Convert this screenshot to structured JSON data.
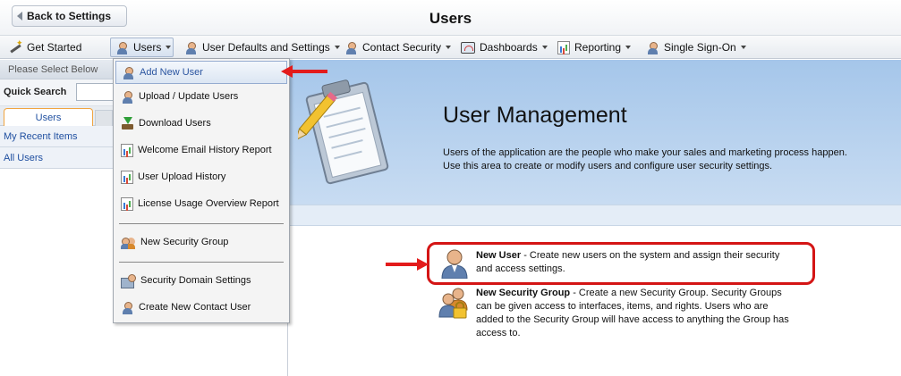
{
  "header": {
    "back_label": "Back to Settings",
    "title": "Users"
  },
  "menubar": {
    "items": [
      {
        "label": "Get Started",
        "icon": "wand-icon"
      },
      {
        "label": "Users",
        "icon": "user-icon"
      },
      {
        "label": "User Defaults and Settings",
        "icon": "user-icon"
      },
      {
        "label": "Contact Security",
        "icon": "user-icon"
      },
      {
        "label": "Dashboards",
        "icon": "dashboard-icon"
      },
      {
        "label": "Reporting",
        "icon": "report-icon"
      },
      {
        "label": "Single Sign-On",
        "icon": "user-icon"
      }
    ]
  },
  "sidebar": {
    "heading": "Please Select Below",
    "quick_search_label": "Quick Search",
    "quick_search_value": "",
    "tab_label": "Users",
    "links": [
      "My Recent Items",
      "All Users"
    ]
  },
  "dropdown": {
    "items": [
      {
        "label": "Add New User",
        "icon": "user-icon"
      },
      {
        "label": "Upload / Update Users",
        "icon": "user-icon"
      },
      {
        "label": "Download Users",
        "icon": "download-icon"
      },
      {
        "label": "Welcome Email History Report",
        "icon": "report-icon"
      },
      {
        "label": "User Upload History",
        "icon": "report-icon"
      },
      {
        "label": "License Usage Overview Report",
        "icon": "report-icon"
      },
      {
        "label": "New Security Group",
        "icon": "group-icon"
      },
      {
        "label": "Security Domain Settings",
        "icon": "domain-icon"
      },
      {
        "label": "Create New Contact User",
        "icon": "user-icon"
      }
    ]
  },
  "banner": {
    "title": "User Management",
    "description": "Users of the application are the people who make your sales and marketing process happen. Use this area to create or modify users and configure user security settings."
  },
  "entries": {
    "new_user": {
      "title": "New User",
      "text": " - Create new users on the system and assign their security and access settings."
    },
    "new_group": {
      "title": "New Security Group",
      "text": " - Create a new Security Group. Security Groups can be given access to interfaces, items, and rights. Users who are added to the Security Group will have access to anything the Group has access to."
    }
  },
  "colors": {
    "accent_red": "#e31b1b",
    "link_blue": "#1f4fa0",
    "banner_blue": "#a5c6ea"
  }
}
